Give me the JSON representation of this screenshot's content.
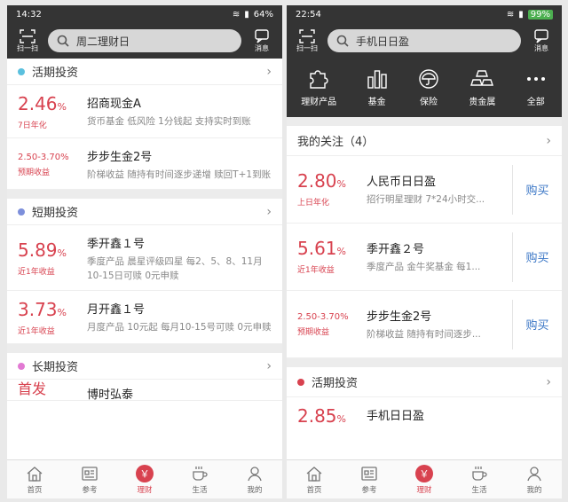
{
  "left": {
    "status": {
      "time": "14:32",
      "battery": "64%"
    },
    "header": {
      "scan": "扫一扫",
      "search": "周二理财日",
      "message": "消息"
    },
    "sections": [
      {
        "title": "活期投资",
        "color": "#5bc0de",
        "products": [
          {
            "rate": "2.46",
            "unit": "%",
            "label": "7日年化",
            "name": "招商现金A",
            "desc": "货币基金 低风险 1分钱起 支持实时到账"
          },
          {
            "rate": "2.50-3.70%",
            "unit": "",
            "label": "预期收益",
            "name": "步步生金2号",
            "desc": "阶梯收益 随持有时间逐步递增 赎回T+1到账",
            "range": true
          }
        ]
      },
      {
        "title": "短期投资",
        "color": "#7d8fdb",
        "products": [
          {
            "rate": "5.89",
            "unit": "%",
            "label": "近1年收益",
            "name": "季开鑫１号",
            "desc": "季度产品 晨星评级四星 每2、5、8、11月10-15日可赎 0元申赎"
          },
          {
            "rate": "3.73",
            "unit": "%",
            "label": "近1年收益",
            "name": "月开鑫１号",
            "desc": "月度产品 10元起 每月10-15号可赎 0元申赎"
          }
        ]
      },
      {
        "title": "长期投资",
        "color": "#e27ad3",
        "products": [
          {
            "rate": "首发",
            "unit": "",
            "label": "",
            "name": "博时弘泰",
            "desc": ""
          }
        ]
      }
    ]
  },
  "right": {
    "status": {
      "time": "22:54",
      "battery": "99%"
    },
    "header": {
      "scan": "扫一扫",
      "search": "手机日日盈",
      "message": "消息"
    },
    "categories": [
      "理财产品",
      "基金",
      "保险",
      "贵金属",
      "全部"
    ],
    "watch": {
      "title": "我的关注（4）",
      "buy": "购买",
      "items": [
        {
          "rate": "2.80",
          "unit": "%",
          "label": "上日年化",
          "name": "人民币日日盈",
          "desc": "招行明星理财 7*24小时交..."
        },
        {
          "rate": "5.61",
          "unit": "%",
          "label": "近1年收益",
          "name": "季开鑫２号",
          "desc": "季度产品 金牛奖基金 每1..."
        },
        {
          "rate": "2.50-3.70%",
          "unit": "",
          "label": "预期收益",
          "name": "步步生金2号",
          "desc": "阶梯收益 随持有时间逐步...",
          "range": true
        }
      ]
    },
    "current": {
      "title": "活期投资",
      "color": "#d8424f",
      "item": {
        "rate": "2.85",
        "unit": "%",
        "name": "手机日日盈"
      }
    }
  },
  "tabs": [
    "首页",
    "参考",
    "理财",
    "生活",
    "我的"
  ],
  "active_tab": 2,
  "colors": {
    "accent": "#d8424f",
    "link": "#3b77c6",
    "dark": "#343434"
  }
}
